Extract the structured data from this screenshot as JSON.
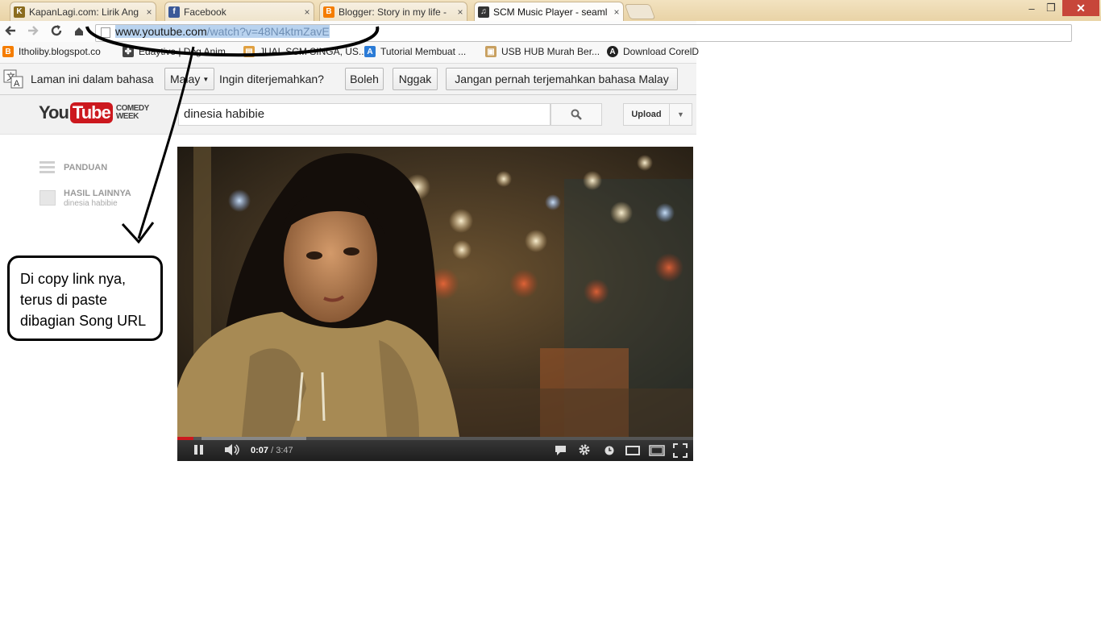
{
  "browser": {
    "tabs": [
      {
        "title": "KapanLagi.com: Lirik Ang",
        "favicon": "kapanlagi-icon",
        "color": "#8a6b1e"
      },
      {
        "title": "Facebook",
        "favicon": "facebook-icon",
        "color": "#3b5998"
      },
      {
        "title": "Blogger: Story in my life -",
        "favicon": "blogger-icon",
        "color": "#f57d00"
      },
      {
        "title": "SCM Music Player - seaml",
        "favicon": "music-note-icon",
        "color": "#333333",
        "active": true
      }
    ],
    "tab_close_glyph": "×",
    "window_buttons": {
      "minimize": "–",
      "maximize": "❐",
      "close": "✕"
    },
    "url": {
      "host": "www.youtube.com",
      "path": "/watch?v=48N4ktmZavE"
    },
    "bookmarks": [
      {
        "label": "Itholiby.blogspot.co",
        "icon": "blogger-icon",
        "color": "#f57d00"
      },
      {
        "label": "Edaytive | Dog Anim",
        "icon": "paw-icon",
        "color": "#444444"
      },
      {
        "label": "JUAL SCM SINGA, US...",
        "icon": "page-icon",
        "color": "#e0a040"
      },
      {
        "label": "Tutorial Membuat ...",
        "icon": "a-logo-icon",
        "color": "#2b7bd6"
      },
      {
        "label": "USB HUB Murah Ber...",
        "icon": "image-icon",
        "color": "#c8a060"
      },
      {
        "label": "Download CorelD",
        "icon": "a-badge-icon",
        "color": "#222222"
      }
    ]
  },
  "translate_bar": {
    "prefix": "Laman ini dalam bahasa",
    "language": "Malay",
    "question": "Ingin diterjemahkan?",
    "yes": "Boleh",
    "no": "Nggak",
    "never": "Jangan pernah terjemahkan bahasa Malay"
  },
  "youtube": {
    "logo_you": "You",
    "logo_tube": "Tube",
    "logo_tag1": "COMEDY",
    "logo_tag2": "WEEK",
    "search_value": "dinesia habibie",
    "upload_label": "Upload",
    "guide": {
      "panduan": "PANDUAN",
      "more_label": "HASIL LAINNYA",
      "more_sub": "dinesia habibie"
    },
    "player": {
      "current_time": "0:07",
      "separator": " / ",
      "duration": "3:47",
      "progress_fraction": 0.031
    }
  },
  "annotation": {
    "callout_text": "Di copy link nya,\nterus di paste\ndibagian Song URL"
  }
}
